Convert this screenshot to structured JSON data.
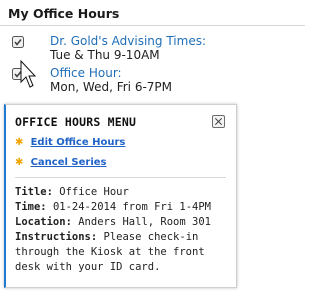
{
  "section": {
    "title": "My Office Hours"
  },
  "items": [
    {
      "title": "Dr. Gold's Advising Times:",
      "schedule": "Tue & Thu 9-10AM",
      "icon": "calendar-check-icon"
    },
    {
      "title": "Office Hour:",
      "schedule": "Mon, Wed, Fri 6-7PM",
      "icon": "calendar-check-icon"
    }
  ],
  "popup": {
    "title": "OFFICE HOURS MENU",
    "close_icon": "close-icon",
    "menu": [
      {
        "label": "Edit Office Hours",
        "icon": "star-icon"
      },
      {
        "label": "Cancel Series",
        "icon": "star-icon"
      }
    ],
    "details": [
      {
        "label": "Title:",
        "value": "Office Hour"
      },
      {
        "label": "Time:",
        "value": "01-24-2014 from Fri 1-4PM"
      },
      {
        "label": "Location:",
        "value": "Anders Hall, Room 301"
      },
      {
        "label": "Instructions:",
        "value": "Please check-in through the Kiosk at the front desk with your ID card."
      }
    ]
  },
  "colors": {
    "link": "#1f63c7",
    "accent_border": "#1f7bd1",
    "star": "#f2a400"
  }
}
